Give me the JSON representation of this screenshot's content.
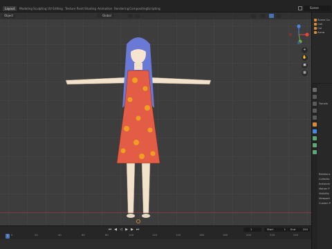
{
  "workspace_tabs": [
    "Layout",
    "Modeling",
    "Sculpting",
    "UV Editing",
    "Texture Paint",
    "Shading",
    "Animation",
    "Rendering",
    "Compositing",
    "Scripting"
  ],
  "active_tab": "Layout",
  "scene": {
    "label": "Scene"
  },
  "viewport": {
    "mode_label": "Object",
    "transform_label": "Global"
  },
  "outliner": {
    "items": [
      "Scene Co",
      "Coll",
      "Col",
      "Arma"
    ]
  },
  "properties": {
    "rows": [
      "Transfo",
      "Relations",
      "Collectio",
      "Instancin",
      "Motion P",
      "Visibility",
      "Viewport",
      "Custom P"
    ]
  },
  "timeline": {
    "current_frame": "1",
    "start_label": "Start",
    "start_value": "1",
    "end_label": "End",
    "end_value": "250",
    "ticks": [
      "0",
      "20",
      "40",
      "60",
      "80",
      "100",
      "120",
      "140",
      "160",
      "180",
      "200",
      "220",
      "240"
    ]
  },
  "colors": {
    "axis_x": "#e8453c",
    "axis_y": "#6ea94a",
    "axis_z": "#4a86e8",
    "accent": "#4772b3",
    "dress": "#e35c45",
    "hair": "#6a78d6"
  },
  "icons": [
    "search-icon",
    "zoom-icon",
    "hand-icon",
    "camera-icon",
    "grid-icon",
    "play-icon"
  ]
}
